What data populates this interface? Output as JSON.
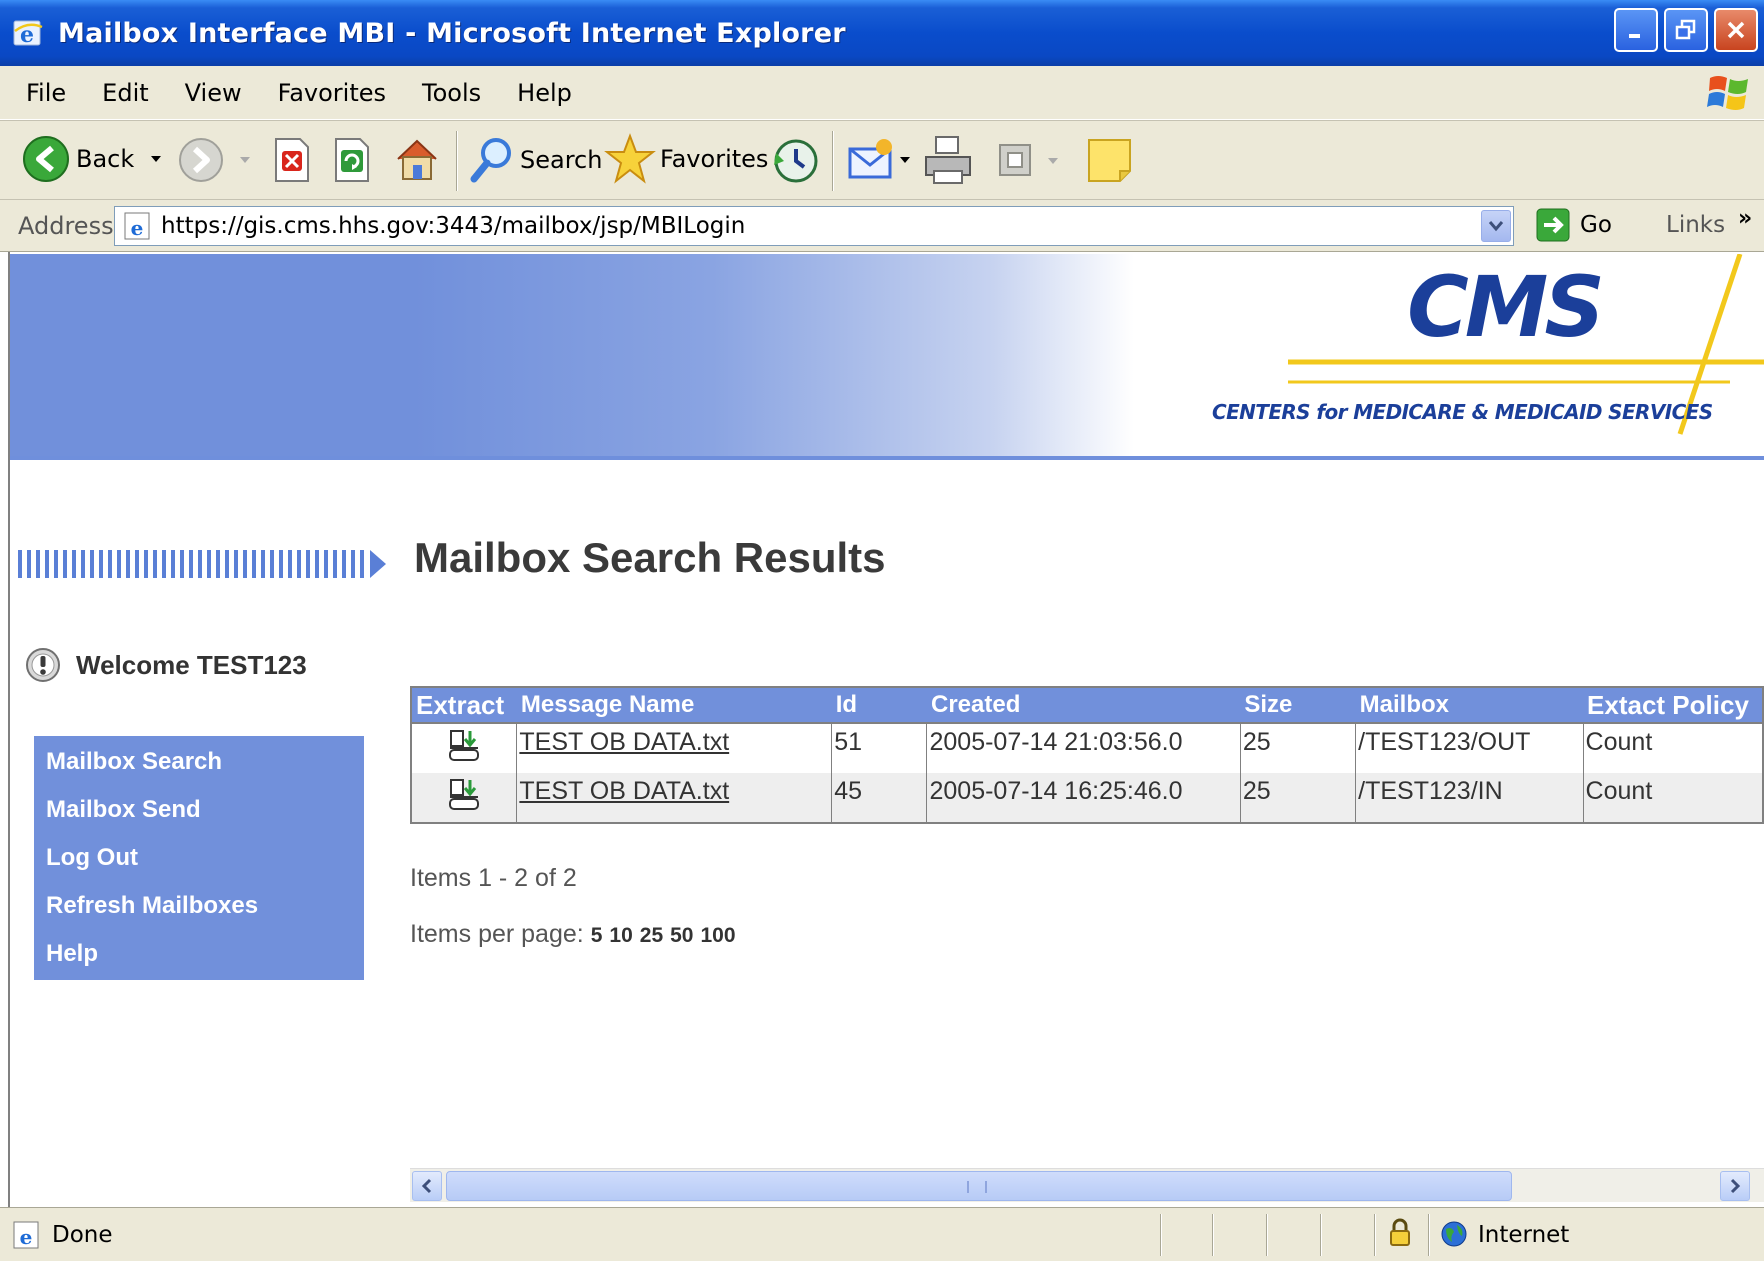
{
  "window": {
    "title": "Mailbox Interface MBI - Microsoft Internet Explorer"
  },
  "menu": {
    "items": [
      "File",
      "Edit",
      "View",
      "Favorites",
      "Tools",
      "Help"
    ]
  },
  "toolbar": {
    "back_label": "Back",
    "search_label": "Search",
    "favorites_label": "Favorites"
  },
  "addressbar": {
    "label": "Address",
    "url": "https://gis.cms.hhs.gov:3443/mailbox/jsp/MBILogin",
    "go_label": "Go",
    "links_label": "Links"
  },
  "banner": {
    "logo_text": "CMS",
    "tagline": "CENTERS for MEDICARE & MEDICAID SERVICES",
    "accent_color": "#7190db",
    "logo_color": "#1b3f9a",
    "cross_color": "#f2c81c"
  },
  "page": {
    "title": "Mailbox Search Results",
    "welcome": "Welcome TEST123"
  },
  "nav": {
    "items": [
      "Mailbox Search",
      "Mailbox Send",
      "Log Out",
      "Refresh Mailboxes",
      "Help"
    ]
  },
  "results": {
    "columns": [
      "Extract",
      "Message Name",
      "Id",
      "Created",
      "Size",
      "Mailbox",
      "Extact Policy"
    ],
    "rows": [
      {
        "message_name": "TEST OB DATA.txt",
        "id": "51",
        "created": "2005-07-14 21:03:56.0",
        "size": "25",
        "mailbox": "/TEST123/OUT",
        "policy": "Count"
      },
      {
        "message_name": "TEST OB DATA.txt",
        "id": "45",
        "created": "2005-07-14 16:25:46.0",
        "size": "25",
        "mailbox": "/TEST123/IN",
        "policy": "Count"
      }
    ],
    "items_range": "Items 1 - 2 of 2",
    "per_page_label": "Items per page:",
    "per_page_options": [
      "5",
      "10",
      "25",
      "50",
      "100"
    ]
  },
  "statusbar": {
    "status": "Done",
    "zone": "Internet"
  }
}
